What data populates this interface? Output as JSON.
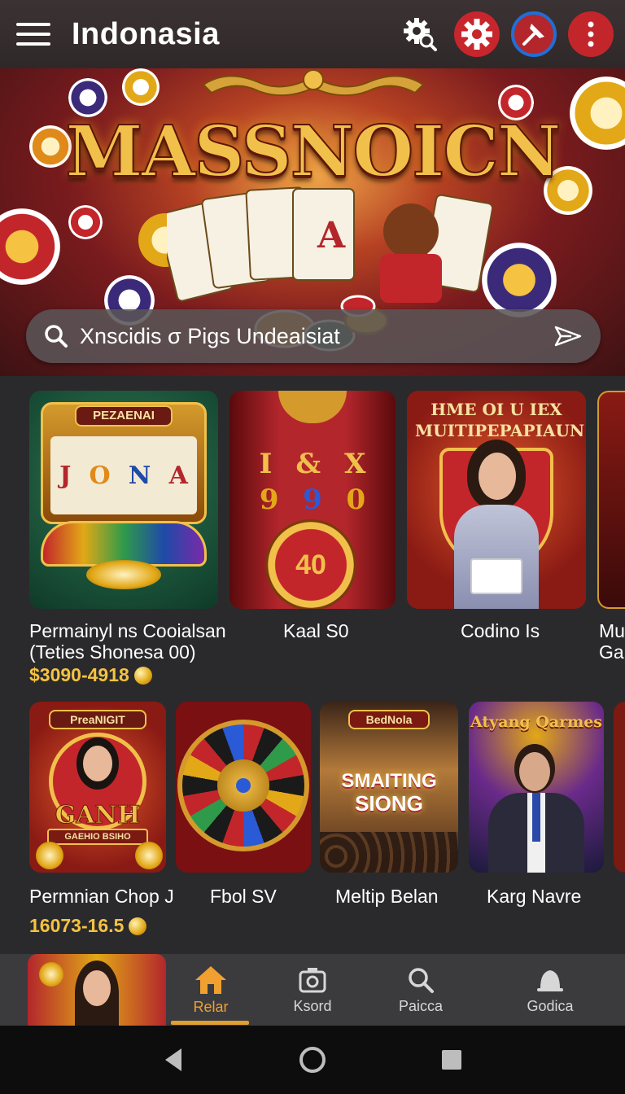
{
  "topbar": {
    "title": "Indonasia",
    "icons": [
      "menu-icon",
      "settings-search-icon",
      "gear-icon",
      "pin-icon",
      "more-vertical-icon"
    ]
  },
  "hero": {
    "title": "MASSNOICN"
  },
  "search": {
    "placeholder": "Xnscidis σ Pigs Undeaisiat"
  },
  "row1": [
    {
      "badge": "PEZAENAI",
      "label_line1": "Permainyl ns Cooialsan",
      "label_line2": "(Teties Shonesa 00)",
      "price": "$3090-4918"
    },
    {
      "label_line1": "Kaal S0",
      "center_text": "40"
    },
    {
      "heading": "HME OI U IEX MUITIPEPAPIAUN",
      "label_line1": "Codino Is"
    },
    {
      "label_line1": "Mul",
      "label_line2": "Gah"
    }
  ],
  "row2": [
    {
      "badge": "PreaNIGIT",
      "logo": "GANH",
      "sub": "GAEHIO BSIHO",
      "label": "Permnian Chop J",
      "price": "16073-16.5"
    },
    {
      "label": "Fbol SV"
    },
    {
      "badge": "BedNola",
      "logo1": "SMAITING",
      "logo2": "SIONG",
      "label": "Meltip Belan"
    },
    {
      "heading": "Atyang Qarmes",
      "label": "Karg Navre"
    }
  ],
  "bottom_nav": [
    {
      "label": "Relar",
      "icon": "home-icon",
      "active": true
    },
    {
      "label": "Ksord",
      "icon": "camera-icon"
    },
    {
      "label": "Paicca",
      "icon": "search-icon"
    },
    {
      "label": "Godica",
      "icon": "bell-icon"
    }
  ],
  "colors": {
    "accent": "#f0a030",
    "price": "#f5c242",
    "topbar_red": "#c7262c",
    "background": "#2a2a2c"
  }
}
